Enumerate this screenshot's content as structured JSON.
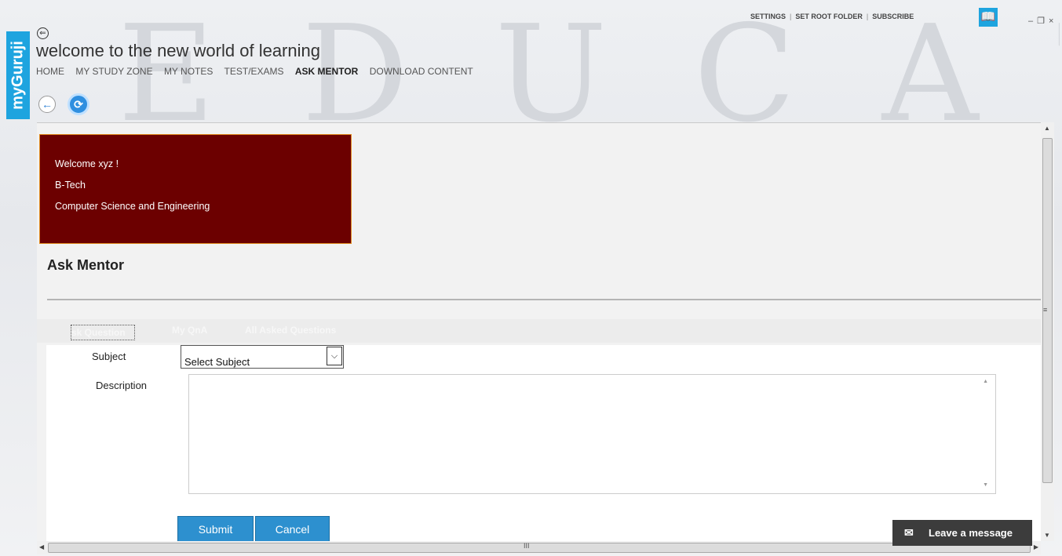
{
  "app": {
    "brand": "myGuruji",
    "title": "welcome to the new world of learning",
    "bg_watermark": "EDUCATE",
    "accent": "#1ea4df"
  },
  "nav": {
    "items": [
      "HOME",
      "MY STUDY ZONE",
      "MY NOTES",
      "TEST/EXAMS",
      "ASK MENTOR",
      "DOWNLOAD CONTENT"
    ],
    "active": "ASK MENTOR"
  },
  "top_links": [
    "SETTINGS",
    "SET ROOT FOLDER",
    "SUBSCRIBE"
  ],
  "top_links_sep": "|",
  "icons": {
    "top_back": "back-arrow-icon",
    "nav_back": "back-arrow-icon",
    "refresh": "refresh-icon",
    "book": "book-icon",
    "minimize": "minimize-icon",
    "restore": "restore-icon",
    "close": "close-icon",
    "mail": "mail-icon"
  },
  "icon_glyphs": {
    "back": "⇐",
    "arrow_left": "←",
    "refresh": "⟳",
    "book": "📖",
    "minimize": "–",
    "restore": "❐",
    "close": "×",
    "chevron_down": "⌵",
    "mail": "✉",
    "scroll_up": "▲",
    "scroll_down": "▼",
    "scroll_left": "◀",
    "scroll_right": "▶",
    "grip_v": "≡",
    "grip_h": "III"
  },
  "profile": {
    "greeting": "Welcome xyz !",
    "program": "B-Tech",
    "branch": "Computer Science and Engineering",
    "bg_color": "#6c0000"
  },
  "page": {
    "title": "Ask Mentor"
  },
  "tabs": [
    {
      "label": "Ask Question",
      "visible_label": "sk Question",
      "active": true
    },
    {
      "label": "My QnA"
    },
    {
      "label": "All Asked Questions"
    }
  ],
  "form": {
    "subject_label": "Subject",
    "subject_value": "Select Subject",
    "description_label": "Description",
    "description_value": "",
    "submit_label": "Submit",
    "cancel_label": "Cancel",
    "button_color": "#2d90cf"
  },
  "chat": {
    "label": "Leave a message"
  }
}
